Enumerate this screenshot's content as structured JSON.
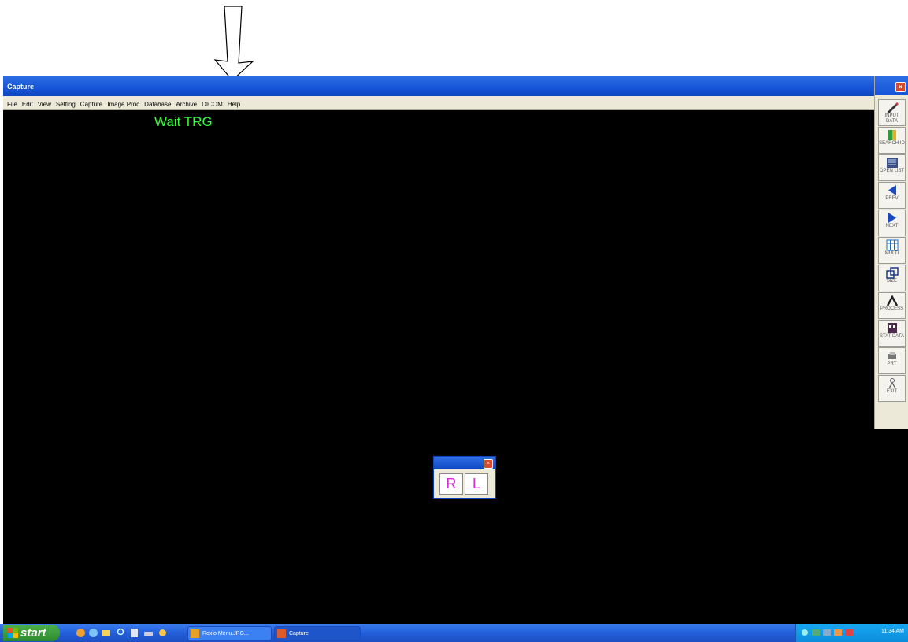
{
  "window": {
    "title": "Capture"
  },
  "menu": [
    "File",
    "Edit",
    "View",
    "Setting",
    "Capture",
    "Image Proc",
    "Database",
    "Archive",
    "DICOM",
    "Help"
  ],
  "status_text": "Wait TRG",
  "toolbar": [
    {
      "label": "INPUT DATA",
      "icon": "pencil-icon"
    },
    {
      "label": "SEARCH ID",
      "icon": "book-icon"
    },
    {
      "label": "OPEN LIST",
      "icon": "list-icon"
    },
    {
      "label": "PREV",
      "icon": "arrow-left-icon"
    },
    {
      "label": "NEXT",
      "icon": "arrow-right-icon"
    },
    {
      "label": "MULTI",
      "icon": "grid-icon"
    },
    {
      "label": "SIZE",
      "icon": "windows-icon"
    },
    {
      "label": "PROCESS",
      "icon": "hammer-icon"
    },
    {
      "label": "STAT DATA",
      "icon": "chart-icon"
    },
    {
      "label": "PRT",
      "icon": "printer-icon"
    },
    {
      "label": "EXIT",
      "icon": "exit-icon"
    }
  ],
  "rl_dialog": {
    "right": "R",
    "left": "L"
  },
  "taskbar": {
    "start": "start",
    "tasks": [
      "Roxio Menu.JPG...",
      "Capture"
    ],
    "clock": "11:34 AM"
  },
  "colors": {
    "status": "#33ff33",
    "rl_letters": "#d62bd6",
    "title_blue": "#1655d8"
  }
}
